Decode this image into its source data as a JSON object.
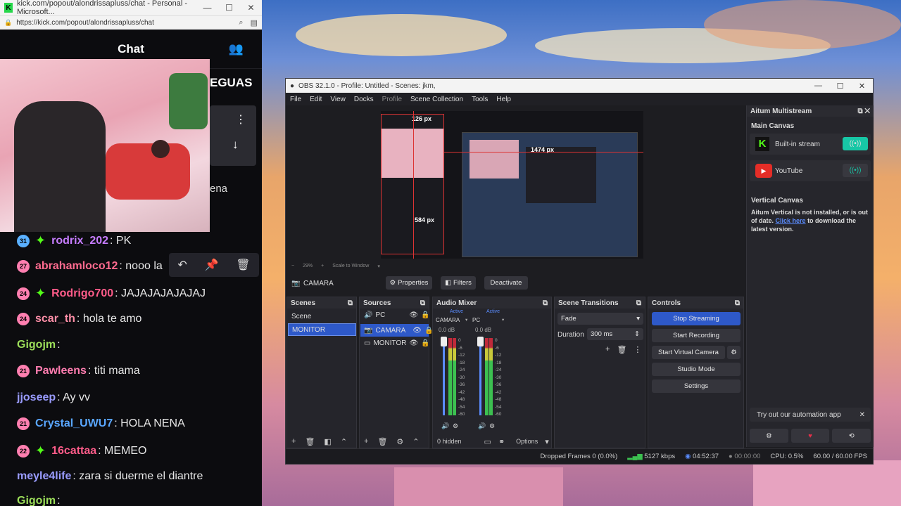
{
  "browser": {
    "title": "kick.com/popout/alondrissapluss/chat - Personal - Microsoft...",
    "url": "https://kick.com/popout/alondrissapluss/chat",
    "logo_letter": "K",
    "chat_header": "Chat",
    "partial_banner": "EGUAS",
    "partial_text": "ena"
  },
  "chat": [
    {
      "badge": "31",
      "badge_color": "#5ab0ff",
      "star": true,
      "user": "rodrix_202",
      "user_color": "#c77dff",
      "text": ": PK"
    },
    {
      "badge": "27",
      "badge_color": "#ff7fb0",
      "star": false,
      "user": "abrahamloco12",
      "user_color": "#ff6b8f",
      "text": ": nooo la"
    },
    {
      "badge": "24",
      "badge_color": "#ff7fb0",
      "star": true,
      "user": "Rodrigo700",
      "user_color": "#ff5c8a",
      "text": ": JAJAJAJAJAJAJ"
    },
    {
      "badge": "24",
      "badge_color": "#ff7fb0",
      "star": false,
      "user": "scar_th",
      "user_color": "#ff8fa8",
      "text": ": hola te amo"
    },
    {
      "badge": "",
      "badge_color": "",
      "star": false,
      "user": "Gigojm",
      "user_color": "#9cde5a",
      "text": ":"
    },
    {
      "badge": "21",
      "badge_color": "#ff7fb0",
      "star": false,
      "user": "Pawleens",
      "user_color": "#ff7db0",
      "text": ": titi mama"
    },
    {
      "badge": "",
      "badge_color": "",
      "star": false,
      "user": "jjoseep",
      "user_color": "#9a9cff",
      "text": ": Ay vv"
    },
    {
      "badge": "21",
      "badge_color": "#ff7fb0",
      "star": false,
      "user": "Crystal_UWU7",
      "user_color": "#5aa7ff",
      "text": ": HOLA NENA"
    },
    {
      "badge": "22",
      "badge_color": "#ff7fb0",
      "star": true,
      "user": "16cattaa",
      "user_color": "#ff5c8a",
      "text": ": MEMEO"
    },
    {
      "badge": "",
      "badge_color": "",
      "star": false,
      "user": "meyle4life",
      "user_color": "#9a9cff",
      "text": ": zara si duerme el diantre"
    },
    {
      "badge": "",
      "badge_color": "",
      "star": false,
      "user": "Gigojm",
      "user_color": "#9cde5a",
      "text": ":"
    }
  ],
  "obs": {
    "title": "OBS 32.1.0 - Profile: Untitled - Scenes: jkm,",
    "menu": [
      "File",
      "Edit",
      "View",
      "Docks",
      "Profile",
      "Scene Collection",
      "Tools",
      "Help"
    ],
    "preview_labels": {
      "top": "126 px",
      "mid": "1474 px",
      "side": "584 px",
      "zoom": "29%",
      "scale": "Scale to Window"
    },
    "source_bar": {
      "name": "CAMARA",
      "properties": "Properties",
      "filters": "Filters",
      "deactivate": "Deactivate"
    },
    "scenes": {
      "title": "Scenes",
      "items": [
        "Scene",
        "MONITOR"
      ]
    },
    "sources": {
      "title": "Sources",
      "items": [
        "PC",
        "CAMARA",
        "MONITOR"
      ]
    },
    "mixer": {
      "title": "Audio Mixer",
      "channels": [
        {
          "name": "CAMARA",
          "status": "Active",
          "db": "0.0 dB"
        },
        {
          "name": "PC",
          "status": "Active",
          "db": "0.0 dB"
        }
      ],
      "ticks": [
        "0",
        "-6",
        "-12",
        "-18",
        "-24",
        "-30",
        "-36",
        "-42",
        "-48",
        "-54",
        "-60"
      ],
      "hidden": "0 hidden",
      "options": "Options"
    },
    "transitions": {
      "title": "Scene Transitions",
      "type": "Fade",
      "duration_label": "Duration",
      "duration": "300 ms"
    },
    "controls": {
      "title": "Controls",
      "stop_streaming": "Stop Streaming",
      "start_recording": "Start Recording",
      "start_virtual_camera": "Start Virtual Camera",
      "studio_mode": "Studio Mode",
      "settings": "Settings"
    },
    "aitum": {
      "title": "Aitum Multistream",
      "main_canvas": "Main Canvas",
      "builtin": "Built-in stream",
      "youtube": "YouTube",
      "vertical_canvas": "Vertical Canvas",
      "vertical_msg": "Aitum Vertical is not installed, or is out of date.",
      "link": "Click here",
      "link_rest": " to download the latest version.",
      "automation": "Try out our automation app"
    },
    "status": {
      "dropped": "Dropped Frames 0 (0.0%)",
      "kbps": "5127 kbps",
      "live_time": "04:52:37",
      "rec_time": "00:00:00",
      "cpu": "CPU: 0.5%",
      "fps": "60.00 / 60.00 FPS"
    }
  }
}
